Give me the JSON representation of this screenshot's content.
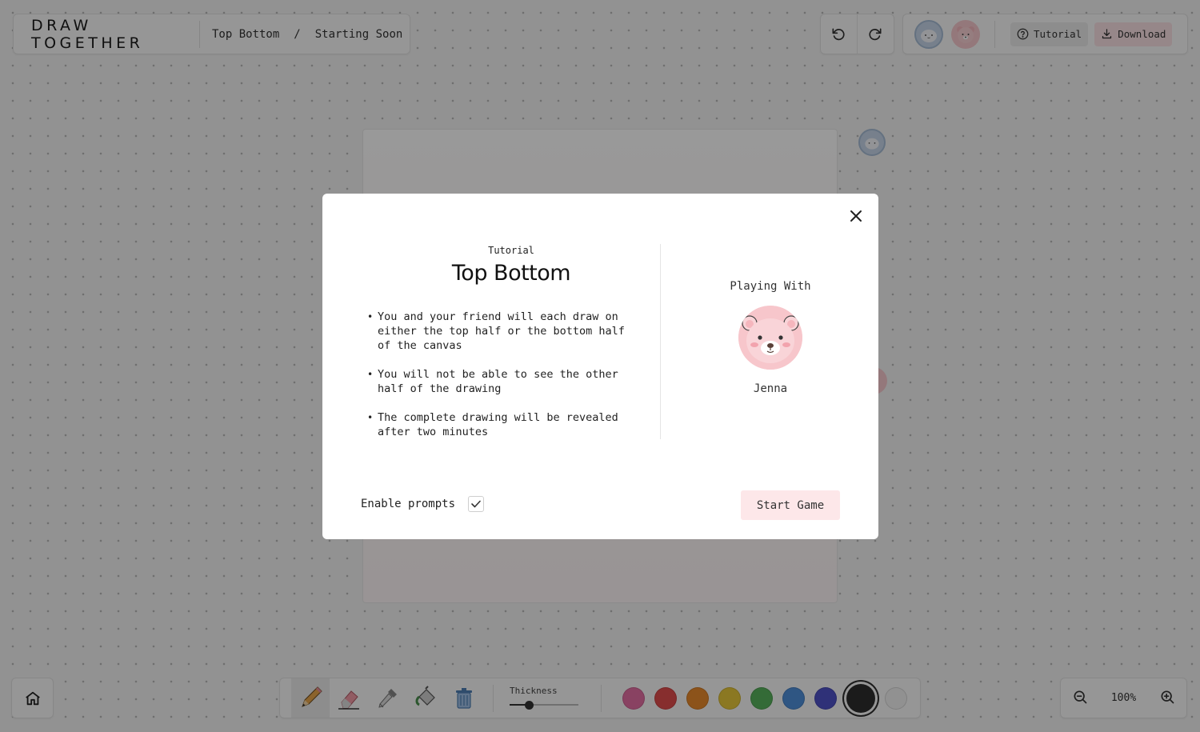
{
  "app": {
    "brand": "DRAW TOGETHER",
    "breadcrumb": {
      "game": "Top Bottom",
      "separator": "/",
      "status": "Starting Soon"
    }
  },
  "header": {
    "undo_icon": "undo-icon",
    "redo_icon": "redo-icon",
    "tutorial_label": "Tutorial",
    "download_label": "Download"
  },
  "toolbar": {
    "tools": [
      "pencil-icon",
      "eraser-icon",
      "eyedropper-icon",
      "paint-bucket-icon",
      "trash-icon"
    ],
    "active_tool": "pencil",
    "thickness_label": "Thickness",
    "thickness_level": 0.22,
    "colors": [
      "#e56ea3",
      "#e14d4d",
      "#e98a2c",
      "#e8c93a",
      "#58b25c",
      "#4f8fda",
      "#4f52c8",
      "#2d2d2d",
      "#f2f2f2"
    ],
    "selected_color": "#2d2d2d"
  },
  "zoom": {
    "value": "100%"
  },
  "modal": {
    "mini_label": "Tutorial",
    "title": "Top Bottom",
    "rules": [
      "You and your friend will each draw on either the top half or the bottom half of the canvas",
      "You will not be able to see the other half of the drawing",
      "The complete drawing will be revealed after two minutes"
    ],
    "playing_with_label": "Playing With",
    "partner_name": "Jenna",
    "enable_prompts_label": "Enable prompts",
    "enable_prompts_checked": true,
    "start_button": "Start Game"
  }
}
